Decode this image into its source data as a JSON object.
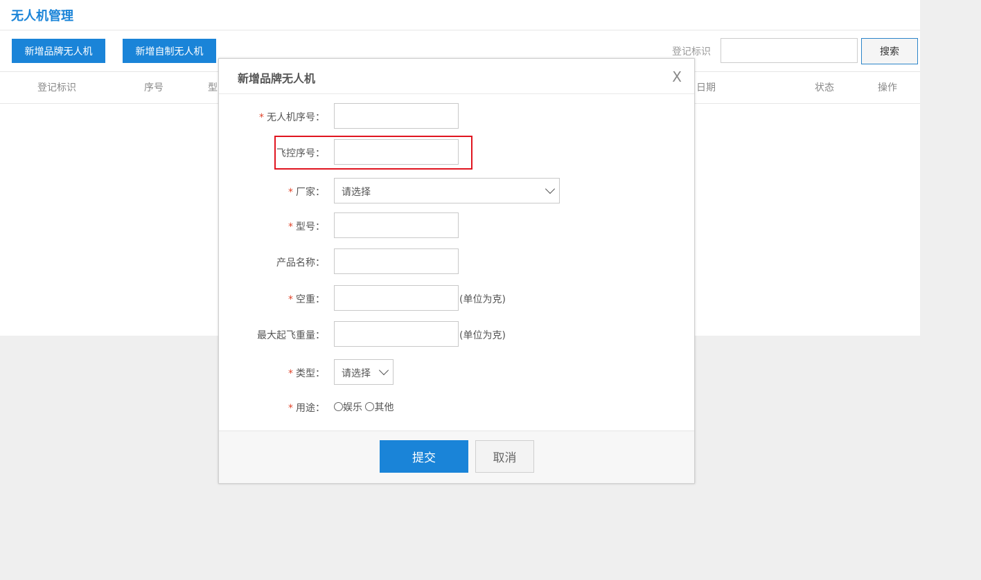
{
  "page": {
    "title": "无人机管理"
  },
  "toolbar": {
    "add_brand_label": "新增品牌无人机",
    "add_custom_label": "新增自制无人机",
    "search_label": "登记标识",
    "search_value": "",
    "search_button": "搜索"
  },
  "table": {
    "headers": [
      "登记标识",
      "序号",
      "型",
      "日期",
      "状态",
      "操作"
    ]
  },
  "modal": {
    "title": "新增品牌无人机",
    "close": "X",
    "fields": {
      "serial": {
        "label": "无人机序号：",
        "required": "*",
        "value": ""
      },
      "fc_serial": {
        "label": "飞控序号：",
        "value": ""
      },
      "manufacturer": {
        "label": "厂家：",
        "required": "*",
        "selected": "请选择"
      },
      "model": {
        "label": "型号：",
        "required": "*",
        "value": ""
      },
      "product_name": {
        "label": "产品名称：",
        "value": ""
      },
      "empty_weight": {
        "label": "空重：",
        "required": "*",
        "value": "",
        "unit": "(单位为克)"
      },
      "max_takeoff_weight": {
        "label": "最大起飞重量：",
        "value": "",
        "unit": "(单位为克)"
      },
      "type": {
        "label": "类型：",
        "required": "*",
        "selected": "请选择"
      },
      "usage": {
        "label": "用途：",
        "required": "*",
        "options": [
          "娱乐",
          "其他"
        ]
      }
    },
    "submit_label": "提交",
    "cancel_label": "取消"
  },
  "colors": {
    "accent": "#1a84d8",
    "required": "#e0452b",
    "highlight": "#e0141f"
  }
}
